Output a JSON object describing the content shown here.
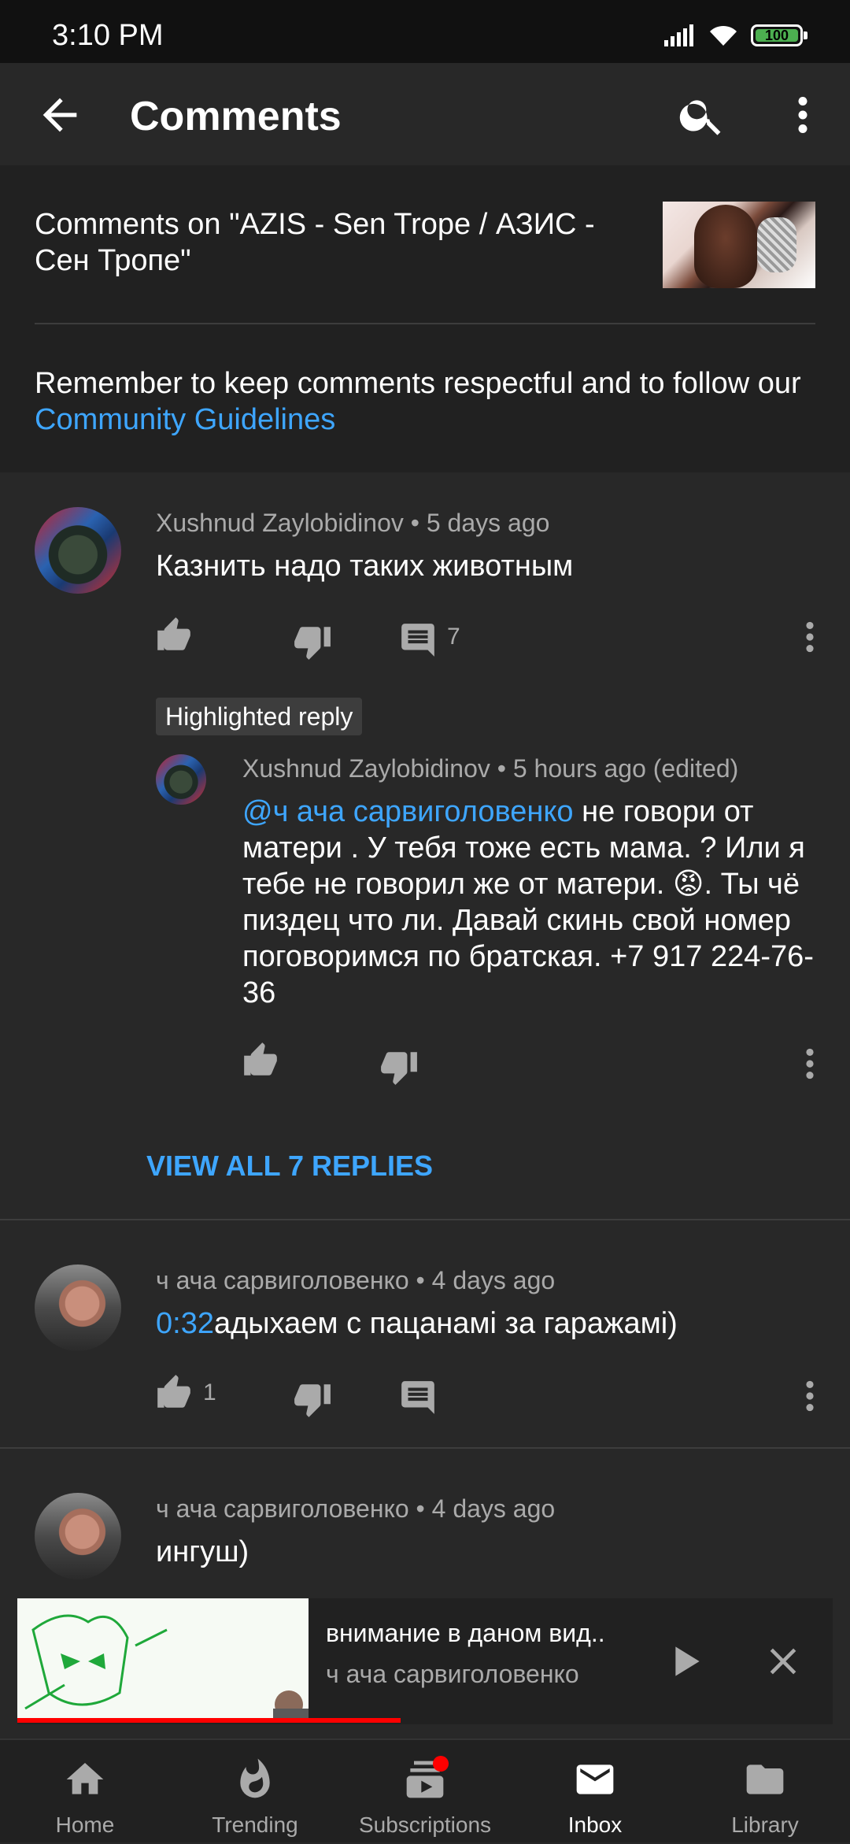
{
  "status": {
    "time": "3:10 PM",
    "battery": "100"
  },
  "appbar": {
    "title": "Comments"
  },
  "header": {
    "video_title": "Comments on \"AZIS  - Sen Trope / АЗИС - Сен Тропе\"",
    "guide_prefix": "Remember to keep comments respectful and to follow our ",
    "guide_link": "Community Guidelines"
  },
  "comments": [
    {
      "author": "Xushnud Zaylobidinov",
      "age": "5 days ago",
      "text": "Казнить надо таких животным",
      "likes": "",
      "replies": "7"
    },
    {
      "author": "ч ача сарвиголовенко",
      "age": "4 days ago",
      "timestamp_link": "0:32",
      "text": "адыхаем с пацанамі за гаражамі)",
      "likes": "1"
    },
    {
      "author": "ч ача сарвиголовенко",
      "age": "4 days ago",
      "text": "ингуш)"
    }
  ],
  "highlighted_reply": {
    "badge": "Highlighted reply",
    "author": "Xushnud Zaylobidinov",
    "age": "5 hours ago (edited)",
    "mention": "@ч ача сарвиголовенко",
    "text": " не говори от матери . У тебя тоже есть мама. ? Или я тебе не говорил же от матери. 😡. Ты чё пиздец что ли. Давай скинь свой номер поговоримся по братская. +7 917 224-76-36"
  },
  "view_all": "VIEW ALL 7 REPLIES",
  "miniplayer": {
    "title": "внимание в даном вид..",
    "channel": "ч ача сарвиголовенко",
    "progress_fraction": 0.47
  },
  "nav": [
    {
      "label": "Home",
      "icon": "home-icon"
    },
    {
      "label": "Trending",
      "icon": "flame-icon"
    },
    {
      "label": "Subscriptions",
      "icon": "subscriptions-icon"
    },
    {
      "label": "Inbox",
      "icon": "mail-icon"
    },
    {
      "label": "Library",
      "icon": "folder-icon"
    }
  ],
  "colors": {
    "link": "#3ea6ff",
    "background": "#282828",
    "accent": "#ff0000"
  }
}
